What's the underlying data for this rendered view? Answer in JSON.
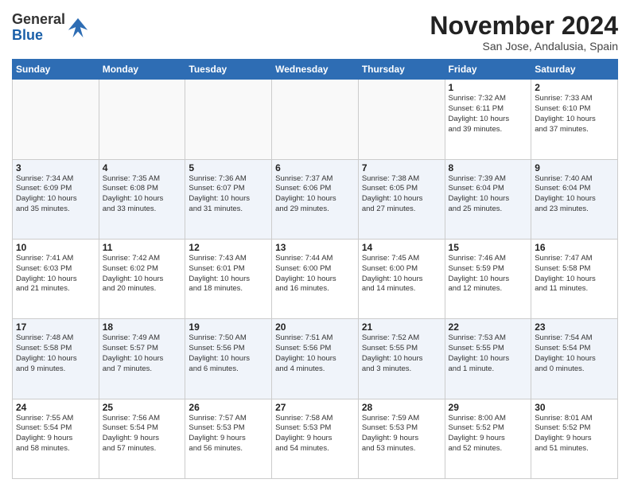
{
  "header": {
    "logo_general": "General",
    "logo_blue": "Blue",
    "month": "November 2024",
    "location": "San Jose, Andalusia, Spain"
  },
  "days_of_week": [
    "Sunday",
    "Monday",
    "Tuesday",
    "Wednesday",
    "Thursday",
    "Friday",
    "Saturday"
  ],
  "weeks": [
    {
      "alt": false,
      "days": [
        {
          "num": "",
          "detail": ""
        },
        {
          "num": "",
          "detail": ""
        },
        {
          "num": "",
          "detail": ""
        },
        {
          "num": "",
          "detail": ""
        },
        {
          "num": "",
          "detail": ""
        },
        {
          "num": "1",
          "detail": "Sunrise: 7:32 AM\nSunset: 6:11 PM\nDaylight: 10 hours\nand 39 minutes."
        },
        {
          "num": "2",
          "detail": "Sunrise: 7:33 AM\nSunset: 6:10 PM\nDaylight: 10 hours\nand 37 minutes."
        }
      ]
    },
    {
      "alt": true,
      "days": [
        {
          "num": "3",
          "detail": "Sunrise: 7:34 AM\nSunset: 6:09 PM\nDaylight: 10 hours\nand 35 minutes."
        },
        {
          "num": "4",
          "detail": "Sunrise: 7:35 AM\nSunset: 6:08 PM\nDaylight: 10 hours\nand 33 minutes."
        },
        {
          "num": "5",
          "detail": "Sunrise: 7:36 AM\nSunset: 6:07 PM\nDaylight: 10 hours\nand 31 minutes."
        },
        {
          "num": "6",
          "detail": "Sunrise: 7:37 AM\nSunset: 6:06 PM\nDaylight: 10 hours\nand 29 minutes."
        },
        {
          "num": "7",
          "detail": "Sunrise: 7:38 AM\nSunset: 6:05 PM\nDaylight: 10 hours\nand 27 minutes."
        },
        {
          "num": "8",
          "detail": "Sunrise: 7:39 AM\nSunset: 6:04 PM\nDaylight: 10 hours\nand 25 minutes."
        },
        {
          "num": "9",
          "detail": "Sunrise: 7:40 AM\nSunset: 6:04 PM\nDaylight: 10 hours\nand 23 minutes."
        }
      ]
    },
    {
      "alt": false,
      "days": [
        {
          "num": "10",
          "detail": "Sunrise: 7:41 AM\nSunset: 6:03 PM\nDaylight: 10 hours\nand 21 minutes."
        },
        {
          "num": "11",
          "detail": "Sunrise: 7:42 AM\nSunset: 6:02 PM\nDaylight: 10 hours\nand 20 minutes."
        },
        {
          "num": "12",
          "detail": "Sunrise: 7:43 AM\nSunset: 6:01 PM\nDaylight: 10 hours\nand 18 minutes."
        },
        {
          "num": "13",
          "detail": "Sunrise: 7:44 AM\nSunset: 6:00 PM\nDaylight: 10 hours\nand 16 minutes."
        },
        {
          "num": "14",
          "detail": "Sunrise: 7:45 AM\nSunset: 6:00 PM\nDaylight: 10 hours\nand 14 minutes."
        },
        {
          "num": "15",
          "detail": "Sunrise: 7:46 AM\nSunset: 5:59 PM\nDaylight: 10 hours\nand 12 minutes."
        },
        {
          "num": "16",
          "detail": "Sunrise: 7:47 AM\nSunset: 5:58 PM\nDaylight: 10 hours\nand 11 minutes."
        }
      ]
    },
    {
      "alt": true,
      "days": [
        {
          "num": "17",
          "detail": "Sunrise: 7:48 AM\nSunset: 5:58 PM\nDaylight: 10 hours\nand 9 minutes."
        },
        {
          "num": "18",
          "detail": "Sunrise: 7:49 AM\nSunset: 5:57 PM\nDaylight: 10 hours\nand 7 minutes."
        },
        {
          "num": "19",
          "detail": "Sunrise: 7:50 AM\nSunset: 5:56 PM\nDaylight: 10 hours\nand 6 minutes."
        },
        {
          "num": "20",
          "detail": "Sunrise: 7:51 AM\nSunset: 5:56 PM\nDaylight: 10 hours\nand 4 minutes."
        },
        {
          "num": "21",
          "detail": "Sunrise: 7:52 AM\nSunset: 5:55 PM\nDaylight: 10 hours\nand 3 minutes."
        },
        {
          "num": "22",
          "detail": "Sunrise: 7:53 AM\nSunset: 5:55 PM\nDaylight: 10 hours\nand 1 minute."
        },
        {
          "num": "23",
          "detail": "Sunrise: 7:54 AM\nSunset: 5:54 PM\nDaylight: 10 hours\nand 0 minutes."
        }
      ]
    },
    {
      "alt": false,
      "days": [
        {
          "num": "24",
          "detail": "Sunrise: 7:55 AM\nSunset: 5:54 PM\nDaylight: 9 hours\nand 58 minutes."
        },
        {
          "num": "25",
          "detail": "Sunrise: 7:56 AM\nSunset: 5:54 PM\nDaylight: 9 hours\nand 57 minutes."
        },
        {
          "num": "26",
          "detail": "Sunrise: 7:57 AM\nSunset: 5:53 PM\nDaylight: 9 hours\nand 56 minutes."
        },
        {
          "num": "27",
          "detail": "Sunrise: 7:58 AM\nSunset: 5:53 PM\nDaylight: 9 hours\nand 54 minutes."
        },
        {
          "num": "28",
          "detail": "Sunrise: 7:59 AM\nSunset: 5:53 PM\nDaylight: 9 hours\nand 53 minutes."
        },
        {
          "num": "29",
          "detail": "Sunrise: 8:00 AM\nSunset: 5:52 PM\nDaylight: 9 hours\nand 52 minutes."
        },
        {
          "num": "30",
          "detail": "Sunrise: 8:01 AM\nSunset: 5:52 PM\nDaylight: 9 hours\nand 51 minutes."
        }
      ]
    }
  ]
}
